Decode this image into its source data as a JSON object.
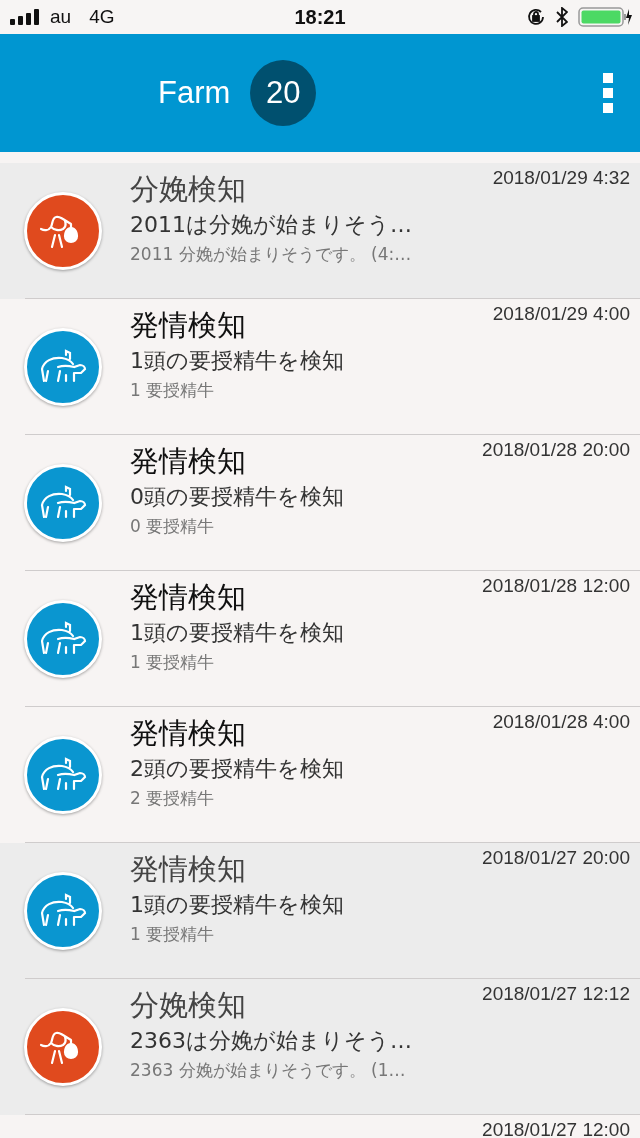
{
  "status_bar": {
    "carrier": "au",
    "network": "4G",
    "time": "18:21"
  },
  "header": {
    "title": "Farm",
    "count": "20"
  },
  "notifications": [
    {
      "kind": "calving",
      "unread": true,
      "title": "分娩検知",
      "summary": "2011は分娩が始まりそう…",
      "detail": "2011 分娩が始まりそうです。 (4:…",
      "time": "2018/01/29 4:32"
    },
    {
      "kind": "estrus",
      "unread": false,
      "title": "発情検知",
      "summary": "1頭の要授精牛を検知",
      "detail": "1 要授精牛",
      "time": "2018/01/29 4:00"
    },
    {
      "kind": "estrus",
      "unread": false,
      "title": "発情検知",
      "summary": "0頭の要授精牛を検知",
      "detail": "0 要授精牛",
      "time": "2018/01/28 20:00"
    },
    {
      "kind": "estrus",
      "unread": false,
      "title": "発情検知",
      "summary": "1頭の要授精牛を検知",
      "detail": "1 要授精牛",
      "time": "2018/01/28 12:00"
    },
    {
      "kind": "estrus",
      "unread": false,
      "title": "発情検知",
      "summary": "2頭の要授精牛を検知",
      "detail": "2 要授精牛",
      "time": "2018/01/28 4:00"
    },
    {
      "kind": "estrus",
      "unread": true,
      "title": "発情検知",
      "summary": "1頭の要授精牛を検知",
      "detail": "1 要授精牛",
      "time": "2018/01/27 20:00"
    },
    {
      "kind": "calving",
      "unread": true,
      "title": "分娩検知",
      "summary": "2363は分娩が始まりそう…",
      "detail": "2363 分娩が始まりそうです。 (1…",
      "time": "2018/01/27 12:12"
    },
    {
      "time": "2018/01/27 12:00"
    }
  ]
}
